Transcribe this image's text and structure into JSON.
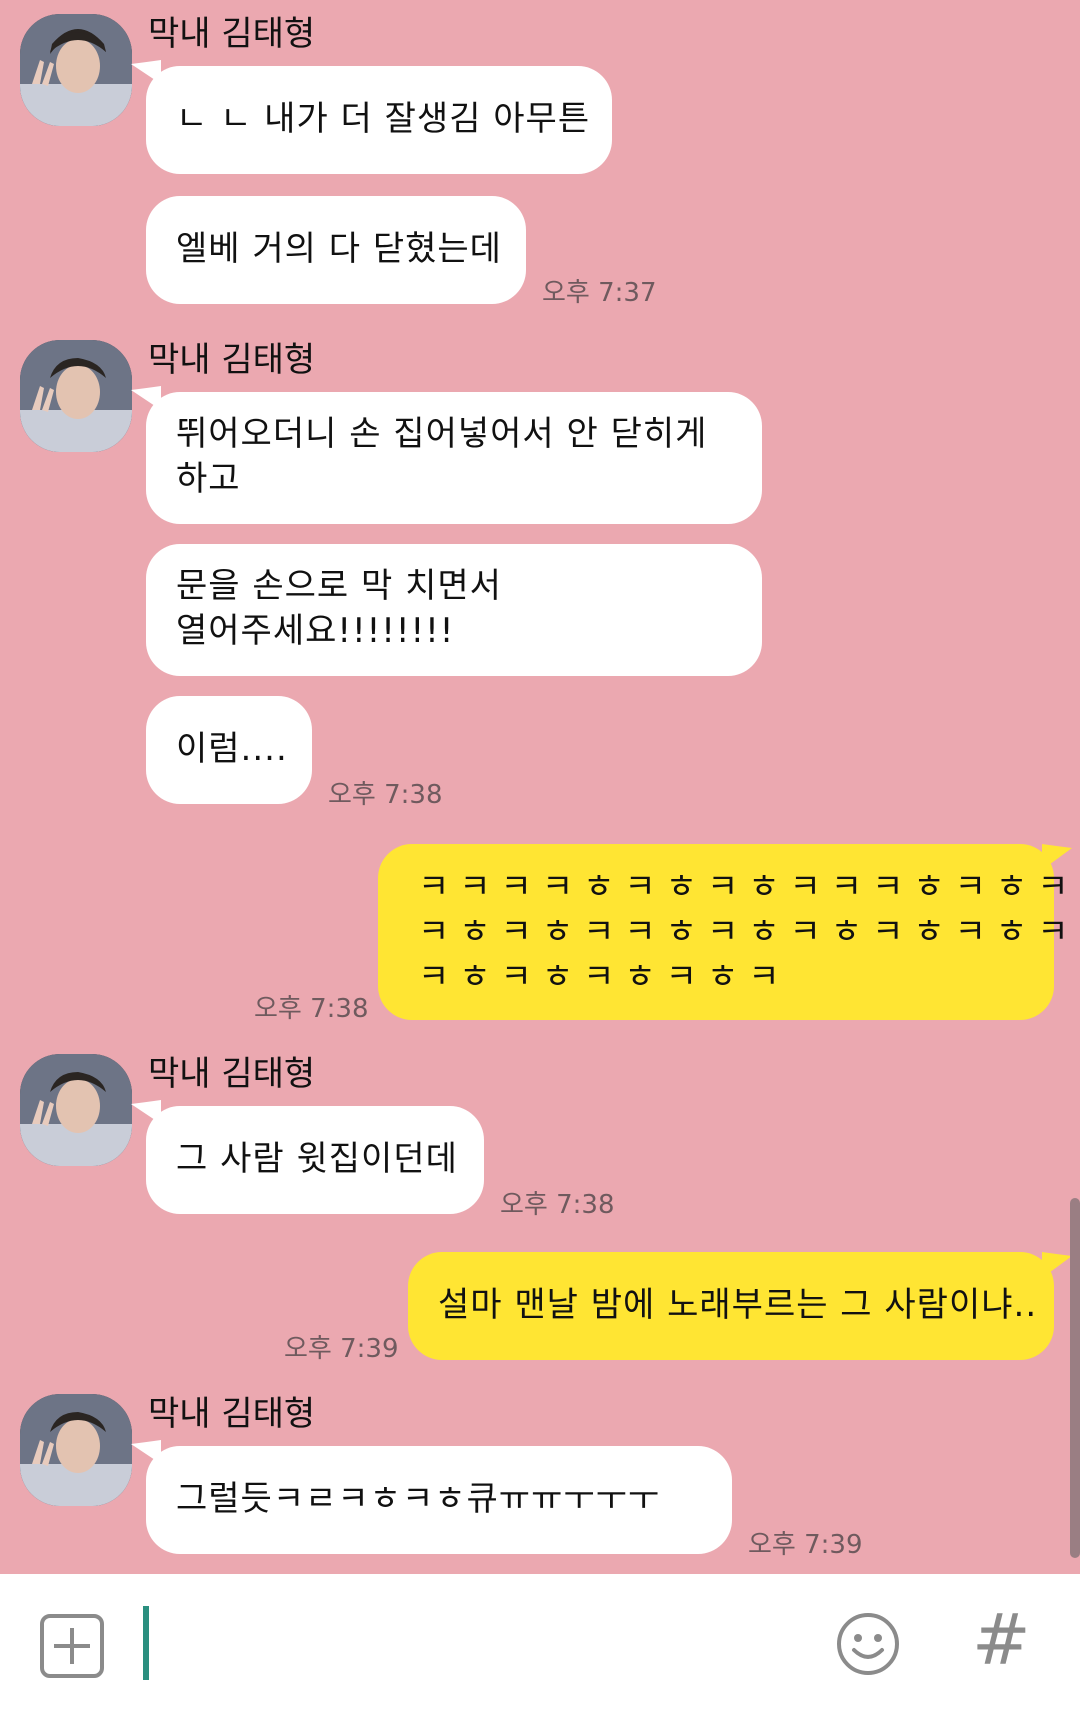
{
  "contact": {
    "name": "막내 김태형"
  },
  "messages": [
    {
      "type": "sender",
      "text": "막내 김태형"
    },
    {
      "type": "in",
      "lines": [
        "ㄴ ㄴ 내가 더 잘생김 아무튼"
      ]
    },
    {
      "type": "in",
      "lines": [
        "엘베 거의 다 닫혔는데"
      ],
      "time": "오후 7:37"
    },
    {
      "type": "sender",
      "text": "막내 김태형"
    },
    {
      "type": "in",
      "lines": [
        "뛰어오더니 손 집어넣어서 안 닫히게",
        "하고"
      ]
    },
    {
      "type": "in",
      "lines": [
        "문을 손으로 막 치면서",
        "열어주세요!!!!!!!!"
      ]
    },
    {
      "type": "in",
      "lines": [
        "이럼...."
      ],
      "time": "오후 7:38"
    },
    {
      "type": "out",
      "lines": [
        "ㅋㅋㅋㅋㅎㅋㅎㅋㅎㅋㅋㅋㅎㅋㅎㅋㅎ",
        "ㅋㅎㅋㅎㅋㅋㅎㅋㅎㅋㅎㅋㅎㅋㅎㅋㅎ",
        "ㅋㅎㅋㅎㅋㅎㅋㅎㅋ"
      ],
      "time": "오후 7:38"
    },
    {
      "type": "sender",
      "text": "막내 김태형"
    },
    {
      "type": "in",
      "lines": [
        "그 사람 윗집이던데"
      ],
      "time": "오후 7:38"
    },
    {
      "type": "out",
      "lines": [
        "설마 맨날 밤에 노래부르는 그 사람이냐.."
      ],
      "time": "오후 7:39"
    },
    {
      "type": "sender",
      "text": "막내 김태형"
    },
    {
      "type": "in",
      "lines": [
        "그럴듯ㅋㄹㅋㅎㅋㅎ큐ㅠㅠㅜㅜㅜ"
      ],
      "time": "오후 7:39"
    }
  ],
  "input_bar": {
    "add_icon": "plus-square-icon",
    "emoji_icon": "smiley-icon",
    "hash_label": "#"
  },
  "colors": {
    "background": "#eba8b0",
    "bubble_in": "#ffffff",
    "bubble_out": "#ffe533",
    "cursor": "#2a8f7f"
  }
}
